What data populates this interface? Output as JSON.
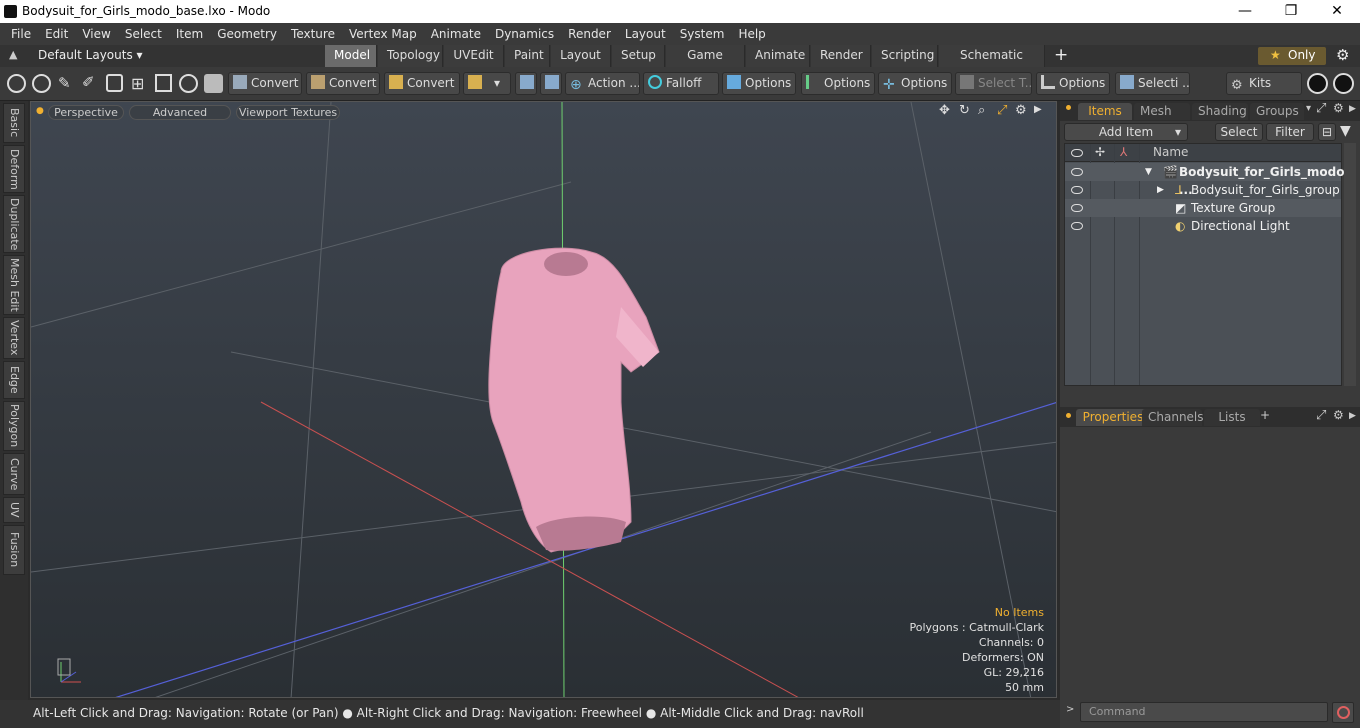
{
  "window": {
    "title": "Bodysuit_for_Girls_modo_base.lxo - Modo",
    "minimize": "—",
    "maximize": "❐",
    "close": "✕"
  },
  "menu": [
    "File",
    "Edit",
    "View",
    "Select",
    "Item",
    "Geometry",
    "Texture",
    "Vertex Map",
    "Animate",
    "Dynamics",
    "Render",
    "Layout",
    "System",
    "Help"
  ],
  "layouts": {
    "selector": "Default Layouts ▾",
    "tabs": [
      "Model",
      "Topology",
      "UVEdit",
      "Paint",
      "Layout",
      "Setup",
      "Game Tools",
      "Animate",
      "Render",
      "Scripting",
      "Schematic Fusion"
    ],
    "active": "Model",
    "add": "+",
    "only": "Only"
  },
  "toolbar": {
    "convert1": "Convert",
    "convert2": "Convert",
    "convert3": "Convert",
    "action": "Action ...",
    "falloff": "Falloff",
    "options1": "Options",
    "options2": "Options",
    "options3": "Options",
    "select_t": "Select T...",
    "options4": "Options",
    "selecti": "Selecti ...",
    "kits": "Kits"
  },
  "left_tabs": [
    "Basic",
    "Deform",
    "Duplicate",
    "Mesh Edit",
    "Vertex",
    "Edge",
    "Polygon",
    "Curve",
    "UV",
    "Fusion"
  ],
  "viewport": {
    "perspective": "Perspective",
    "advanced": "Advanced",
    "textures": "Viewport Textures",
    "info": {
      "no_items": "No Items",
      "polygons": "Polygons : Catmull-Clark",
      "channels": "Channels: 0",
      "deformers": "Deformers: ON",
      "gl": "GL: 29,216",
      "mm": "50 mm"
    }
  },
  "status": "Alt-Left Click and Drag: Navigation: Rotate (or Pan) ● Alt-Right Click and Drag: Navigation: Freewheel ● Alt-Middle Click and Drag: navRoll",
  "items_panel": {
    "tabs": [
      "Items",
      "Mesh ...",
      "Shading",
      "Groups"
    ],
    "add_item": "Add Item",
    "select": "Select",
    "filter": "Filter",
    "name_header": "Name",
    "rows": [
      {
        "label": "Bodysuit_for_Girls_modo ..."
      },
      {
        "label": "Bodysuit_for_Girls_group"
      },
      {
        "label": "Texture Group"
      },
      {
        "label": "Directional Light"
      }
    ]
  },
  "properties_panel": {
    "tabs": [
      "Properties",
      "Channels",
      "Lists"
    ],
    "add": "+"
  },
  "command": {
    "placeholder": "Command"
  },
  "colors": {
    "accent": "#f0b030",
    "model": "#e8a3bd"
  }
}
